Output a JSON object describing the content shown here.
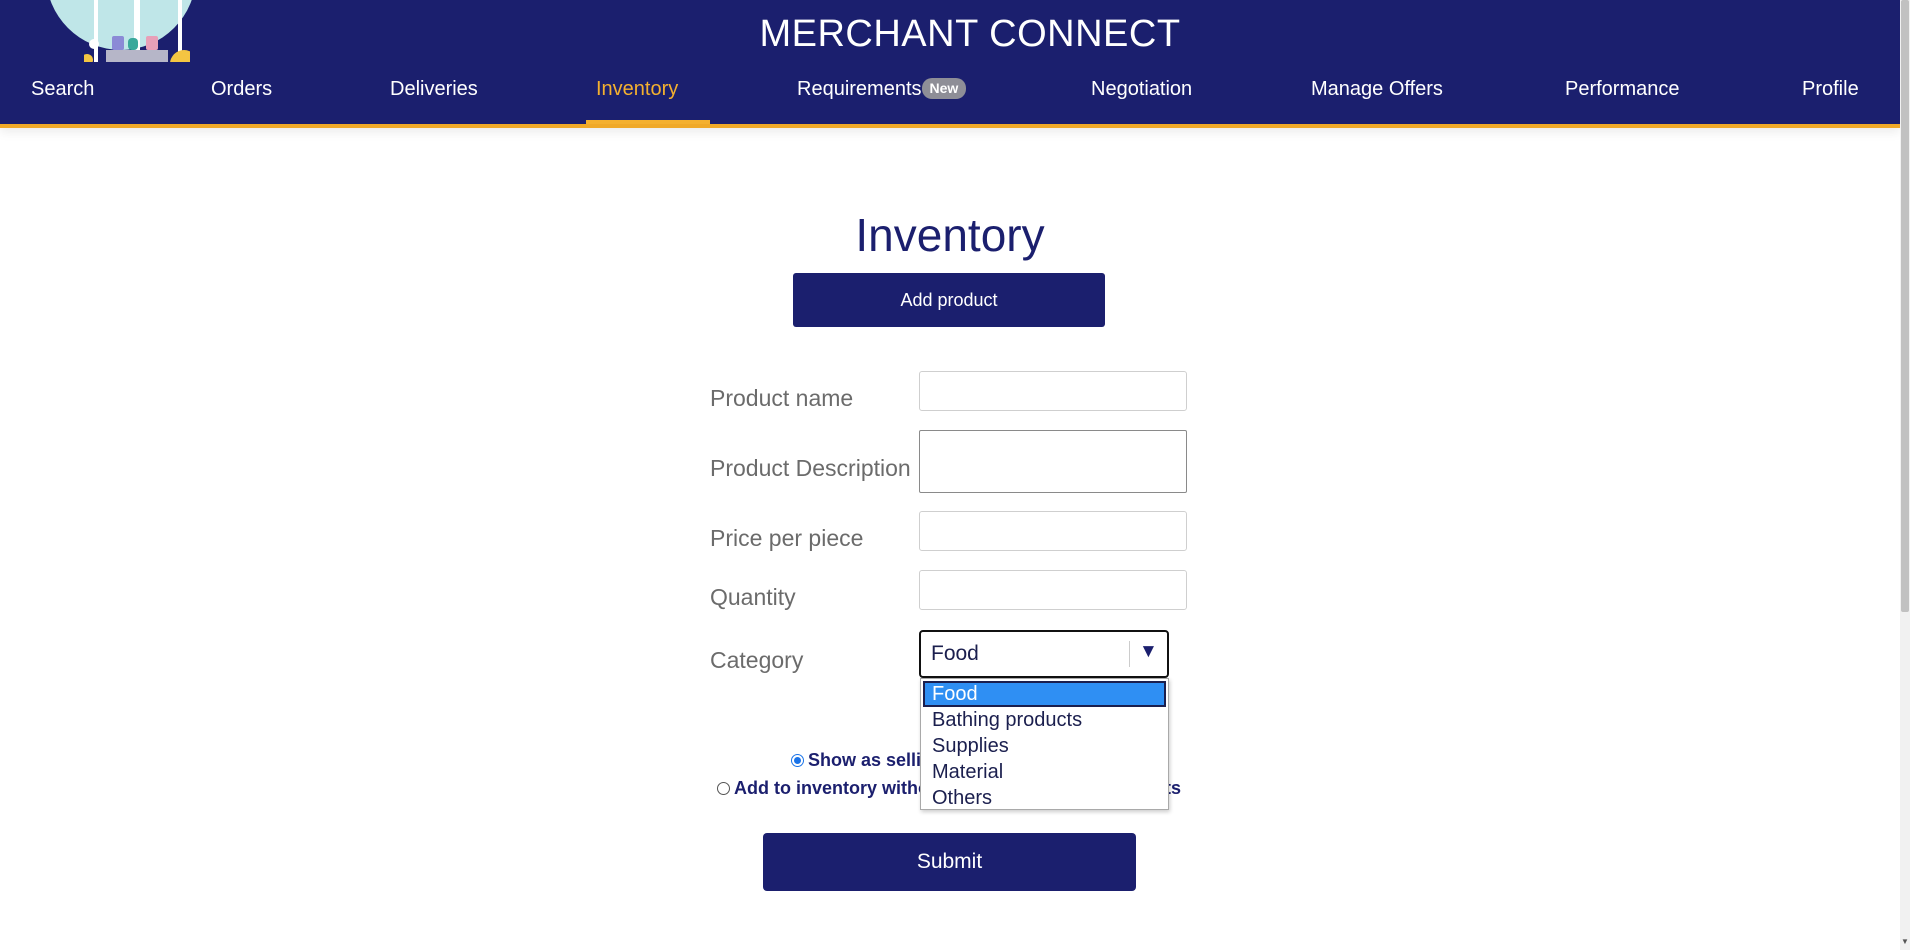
{
  "header": {
    "title": "MERCHANT CONNECT",
    "nav": [
      {
        "label": "Search"
      },
      {
        "label": "Orders"
      },
      {
        "label": "Deliveries"
      },
      {
        "label": "Inventory",
        "active": true
      },
      {
        "label": "Requirements",
        "badge": "New"
      },
      {
        "label": "Negotiation"
      },
      {
        "label": "Manage Offers"
      },
      {
        "label": "Performance"
      },
      {
        "label": "Profile"
      }
    ],
    "accent_color": "#f4b02f",
    "background_color": "#1b1f6e"
  },
  "main": {
    "title": "Inventory",
    "add_product_label": "Add product",
    "form": {
      "product_name_label": "Product name",
      "product_name_value": "",
      "product_description_label": "Product Description",
      "product_description_value": "",
      "price_label": "Price per piece",
      "price_value": "",
      "quantity_label": "Quantity",
      "quantity_value": "",
      "category_label": "Category",
      "category_selected": "Food",
      "category_options": [
        "Food",
        "Bathing products",
        "Supplies",
        "Material",
        "Others"
      ],
      "radio_show_as_selling_visible": "Show as selli",
      "radio_add_inventory_visible_left": "Add to inventory witho",
      "radio_add_inventory_visible_right": "ts",
      "submit_label": "Submit"
    }
  }
}
